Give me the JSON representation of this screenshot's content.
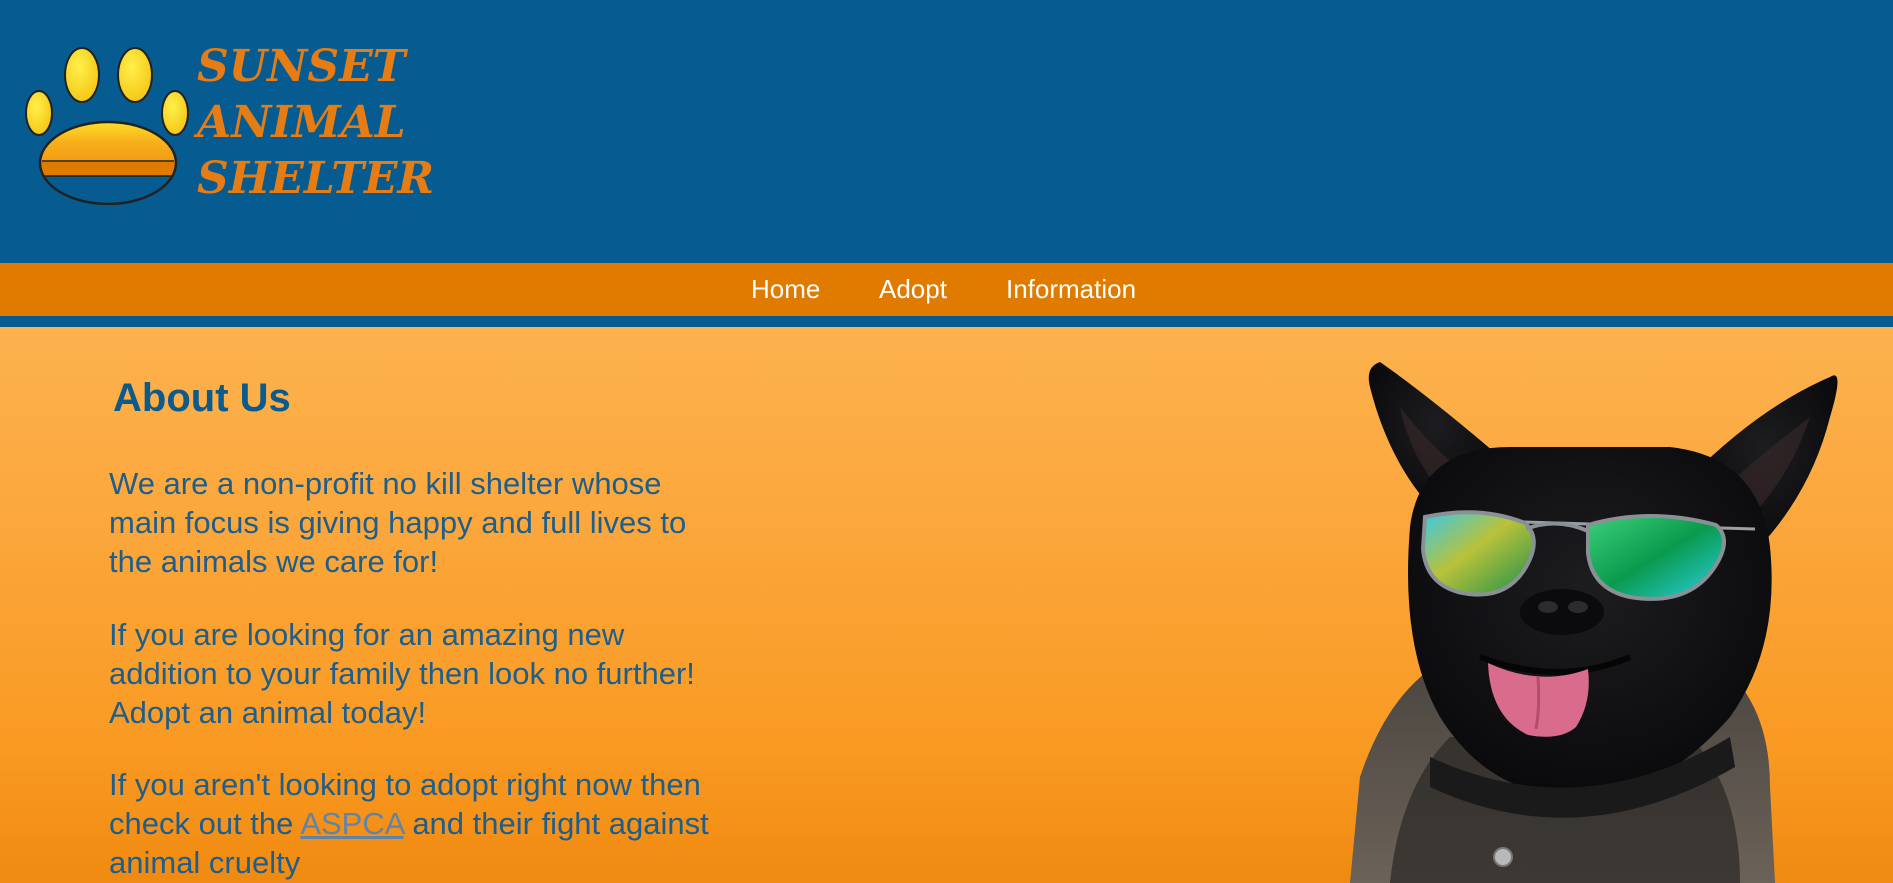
{
  "brand": {
    "line1": "SUNSET",
    "line2": "ANIMAL",
    "line3": "SHELTER"
  },
  "nav": {
    "items": [
      {
        "label": "Home"
      },
      {
        "label": "Adopt"
      },
      {
        "label": "Information"
      }
    ]
  },
  "about": {
    "title": "About Us",
    "para1": "We are a non-profit no kill shelter whose main focus is giving happy and full lives to the animals we care for!",
    "para2": "If you are looking for an amazing new addition to your family then look no further! Adopt an animal today!",
    "para3_before": "If you aren't looking to adopt right now then check out the ",
    "para3_link": "ASPCA",
    "para3_after": " and their fight against animal cruelty"
  },
  "colors": {
    "header_bg": "#065c91",
    "nav_bg": "#e07b00",
    "brand_text": "#e57c14",
    "body_text": "#1e5e8c",
    "link": "#5f84a8"
  },
  "icons": {
    "logo": "paw-print-icon",
    "hero": "dog-with-sunglasses-image"
  }
}
